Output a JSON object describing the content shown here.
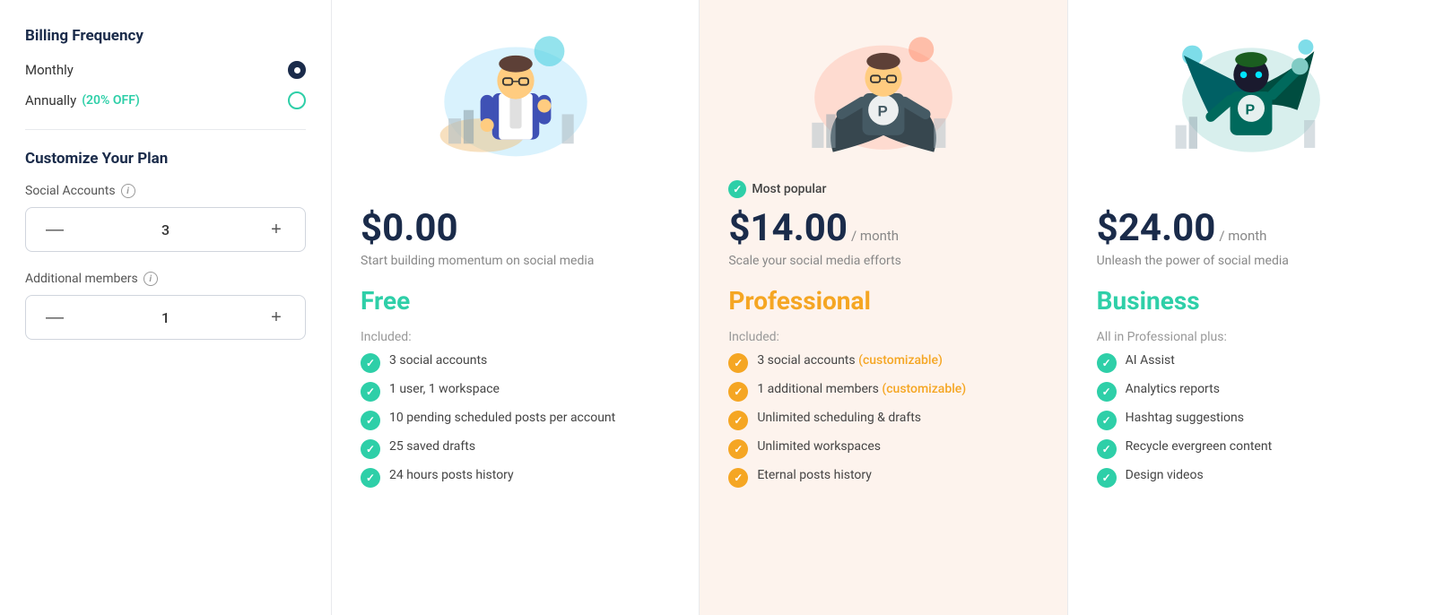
{
  "sidebar": {
    "billing_title": "Billing Frequency",
    "options": [
      {
        "label": "Monthly",
        "selected": true
      },
      {
        "label": "Annually",
        "discount": "(20% OFF)",
        "selected": false
      }
    ],
    "customize_title": "Customize Your Plan",
    "controls": [
      {
        "label": "Social Accounts",
        "info": true,
        "value": 3
      },
      {
        "label": "Additional members",
        "info": true,
        "value": 1
      }
    ]
  },
  "plans": [
    {
      "id": "free",
      "price": "$0.00",
      "period": "",
      "subtitle": "Start building momentum on social media",
      "name": "Free",
      "name_class": "free",
      "most_popular": false,
      "features_label": "Included:",
      "features": [
        {
          "text": "3 social accounts",
          "customizable": false,
          "color": "teal"
        },
        {
          "text": "1 user, 1 workspace",
          "customizable": false,
          "color": "teal"
        },
        {
          "text": "10 pending scheduled posts per account",
          "customizable": false,
          "color": "teal"
        },
        {
          "text": "25 saved drafts",
          "customizable": false,
          "color": "teal"
        },
        {
          "text": "24 hours posts history",
          "customizable": false,
          "color": "teal"
        }
      ]
    },
    {
      "id": "professional",
      "price": "$14.00",
      "period": "/ month",
      "subtitle": "Scale your social media efforts",
      "name": "Professional",
      "name_class": "professional",
      "most_popular": true,
      "most_popular_label": "Most popular",
      "features_label": "Included:",
      "features": [
        {
          "text": "3 social accounts",
          "customizable": true,
          "customizable_label": "(customizable)",
          "color": "orange"
        },
        {
          "text": "1 additional members",
          "customizable": true,
          "customizable_label": "(customizable)",
          "color": "orange"
        },
        {
          "text": "Unlimited scheduling & drafts",
          "customizable": false,
          "color": "orange"
        },
        {
          "text": "Unlimited workspaces",
          "customizable": false,
          "color": "orange"
        },
        {
          "text": "Eternal posts history",
          "customizable": false,
          "color": "orange"
        }
      ]
    },
    {
      "id": "business",
      "price": "$24.00",
      "period": "/ month",
      "subtitle": "Unleash the power of social media",
      "name": "Business",
      "name_class": "business",
      "most_popular": false,
      "features_label": "All in Professional plus:",
      "features": [
        {
          "text": "AI Assist",
          "customizable": false,
          "color": "teal"
        },
        {
          "text": "Analytics reports",
          "customizable": false,
          "color": "teal"
        },
        {
          "text": "Hashtag suggestions",
          "customizable": false,
          "color": "teal"
        },
        {
          "text": "Recycle evergreen content",
          "customizable": false,
          "color": "teal"
        },
        {
          "text": "Design videos",
          "customizable": false,
          "color": "teal"
        }
      ]
    }
  ]
}
